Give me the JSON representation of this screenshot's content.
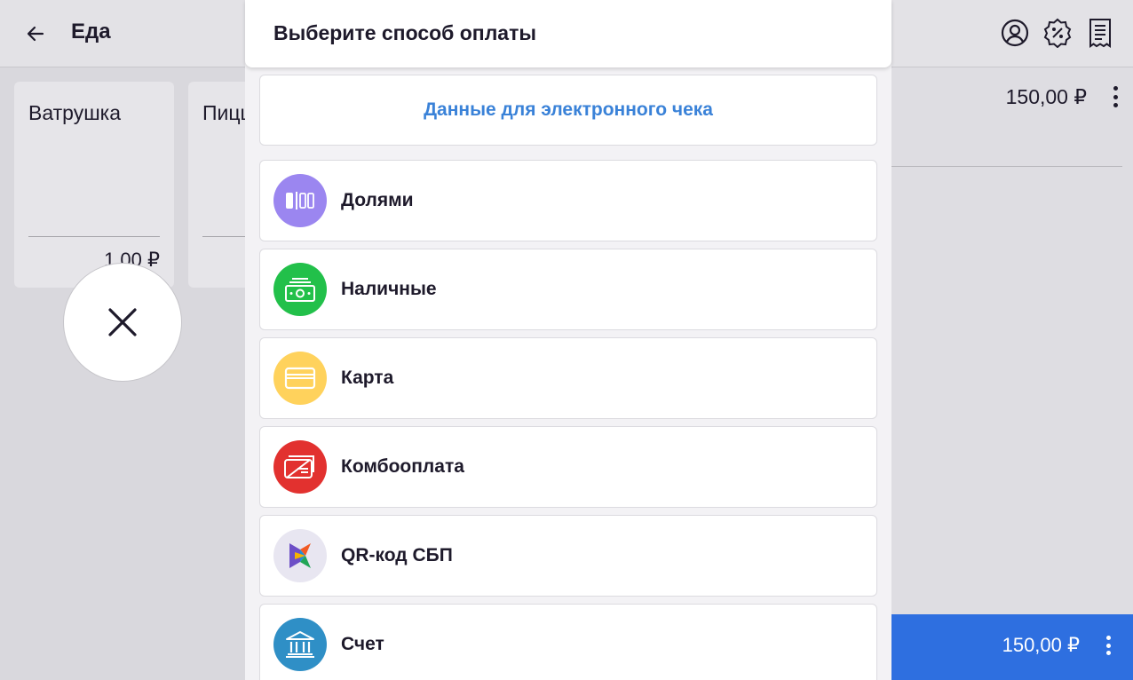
{
  "header": {
    "category_title": "Еда"
  },
  "products": [
    {
      "name": "Ватрушка",
      "price": "1,00 ₽"
    },
    {
      "name": "Пицца",
      "price": ""
    }
  ],
  "cart": {
    "item_price": "150,00 ₽",
    "total": "150,00 ₽"
  },
  "payment_sheet": {
    "title": "Выберите способ оплаты",
    "receipt_button": "Данные для электронного чека",
    "methods": [
      {
        "label": "Долями",
        "icon": "split-payment-icon",
        "color": "#9b86f0"
      },
      {
        "label": "Наличные",
        "icon": "cash-icon",
        "color": "#22c04a"
      },
      {
        "label": "Карта",
        "icon": "card-icon",
        "color": "#ffd25c"
      },
      {
        "label": "Комбооплата",
        "icon": "combo-payment-icon",
        "color": "#e2312f"
      },
      {
        "label": "QR-код СБП",
        "icon": "sbp-icon",
        "color": "#e8e6f1"
      },
      {
        "label": "Счет",
        "icon": "bank-icon",
        "color": "#2f8fc6"
      }
    ]
  },
  "colors": {
    "accent_blue": "#2e6fe0",
    "link_blue": "#3a82d8"
  }
}
